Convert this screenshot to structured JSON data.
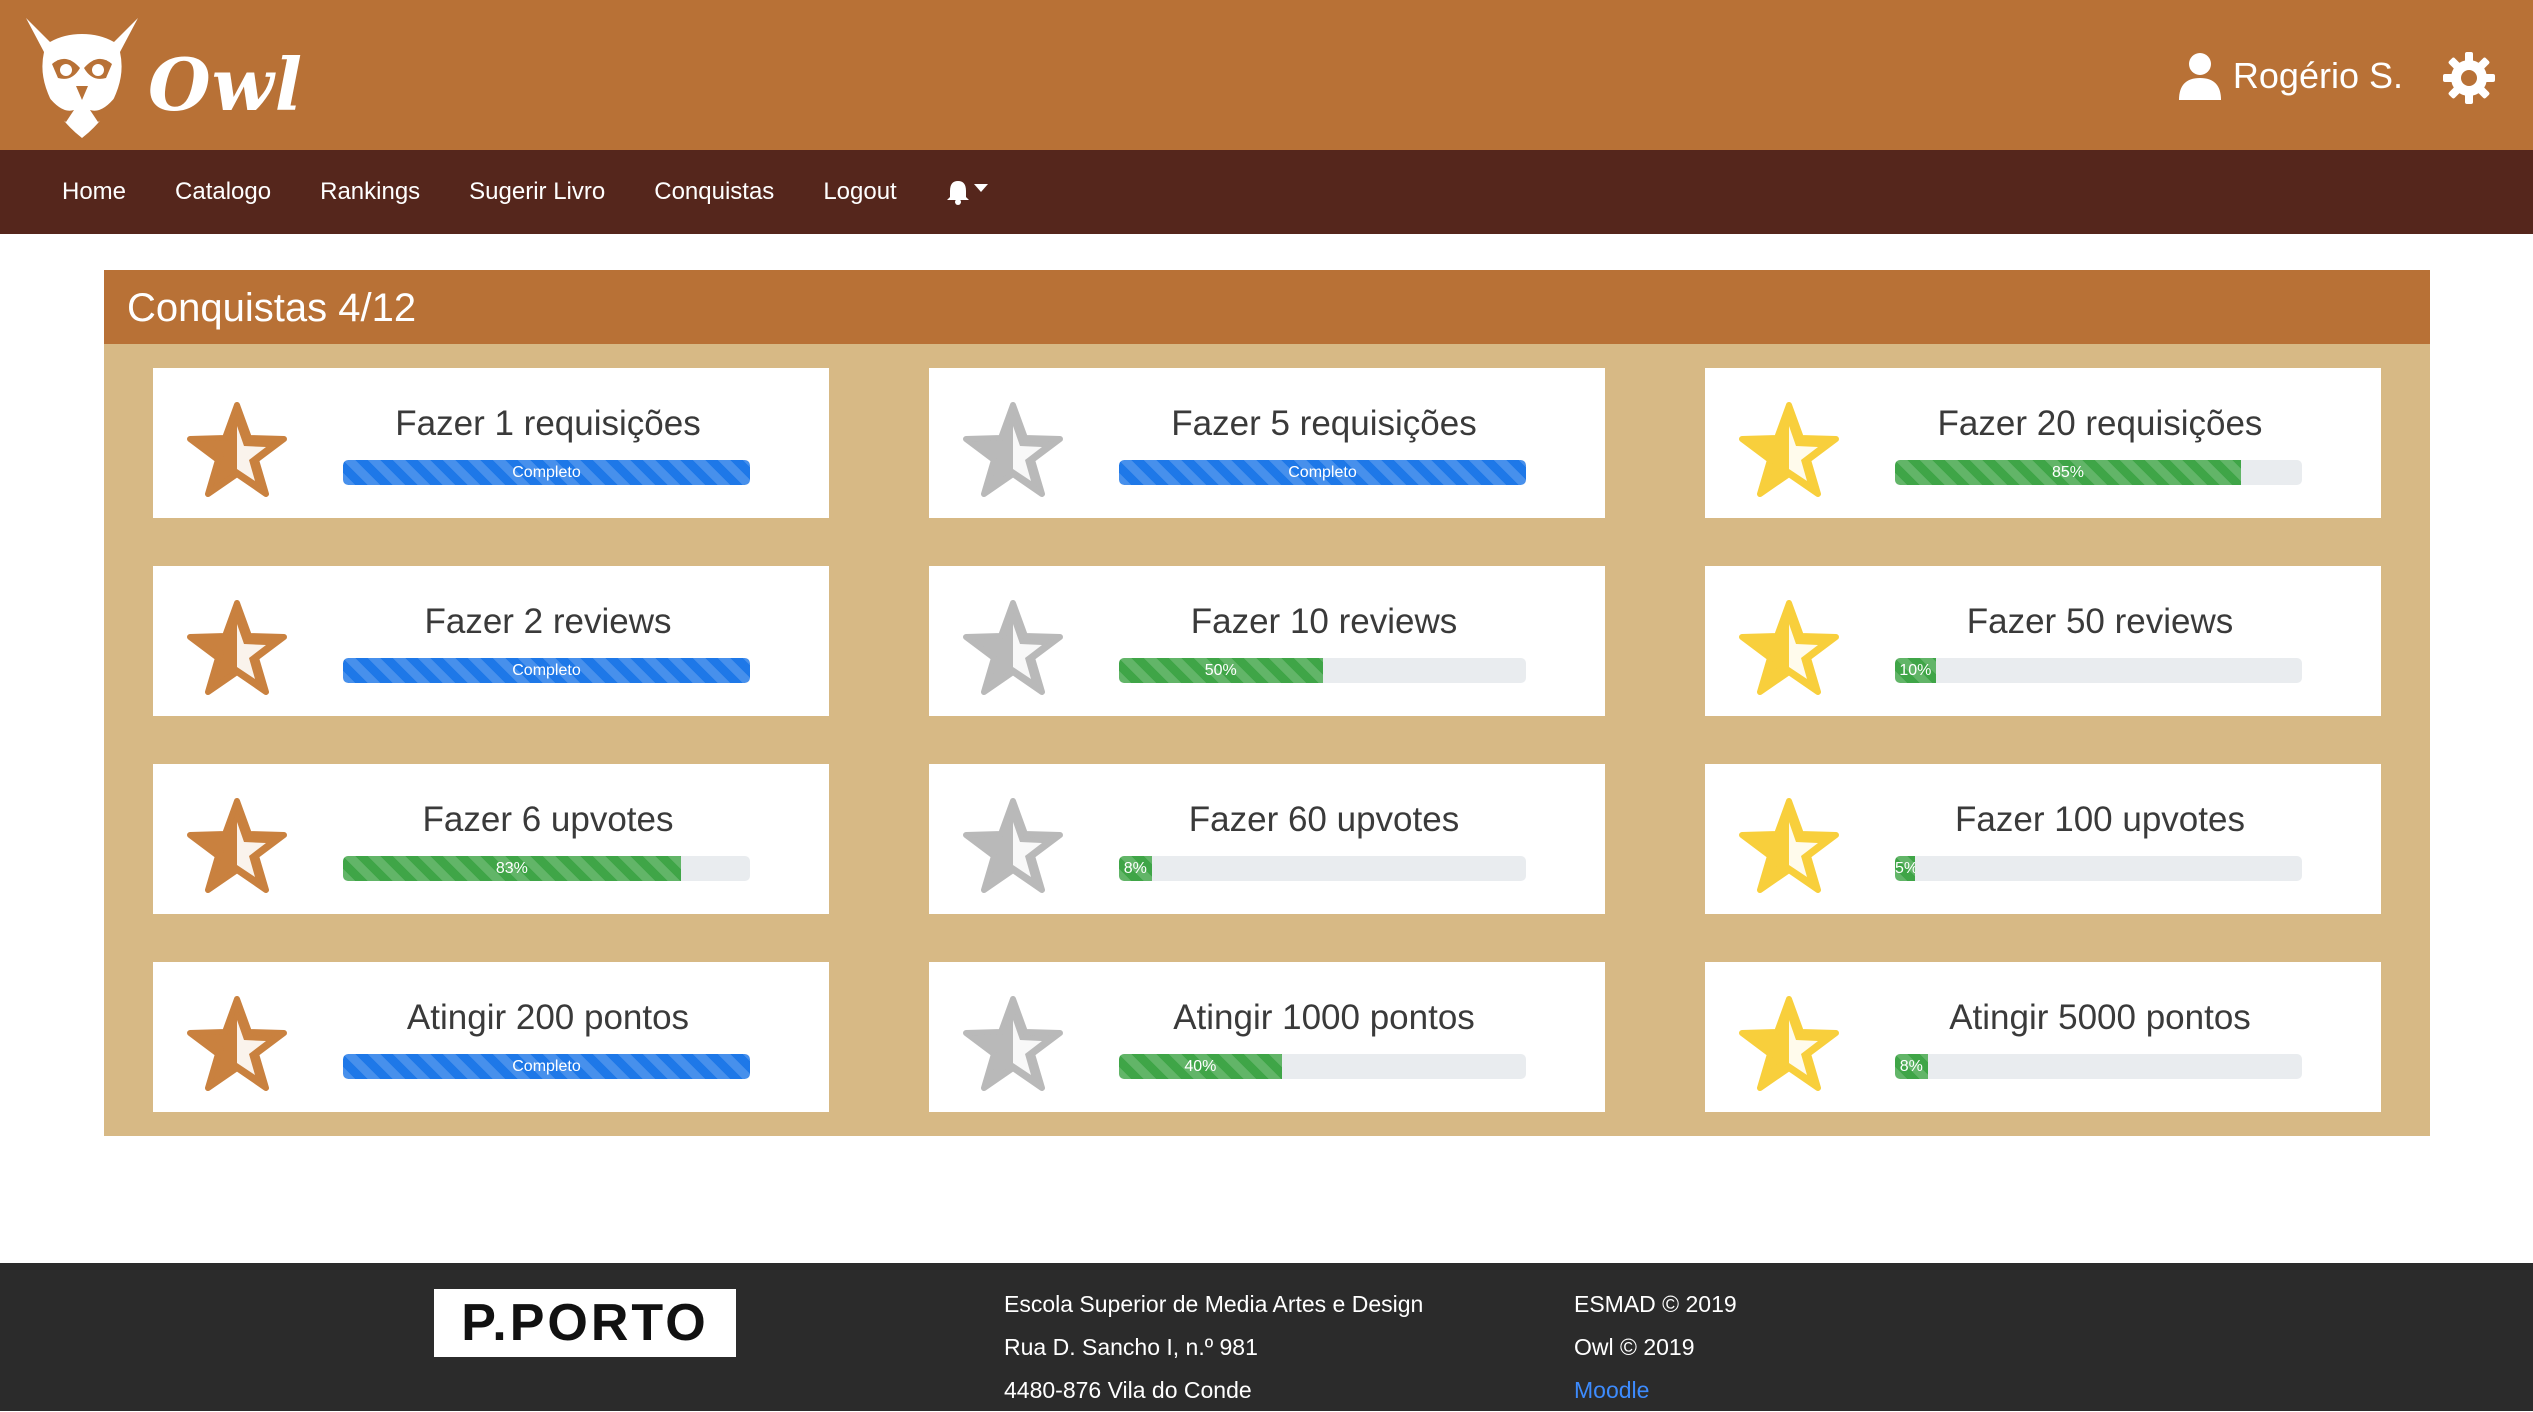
{
  "header": {
    "brand": "Owl",
    "user_name": "Rogério S."
  },
  "nav": {
    "items": [
      "Home",
      "Catalogo",
      "Rankings",
      "Sugerir Livro",
      "Conquistas",
      "Logout"
    ]
  },
  "panel": {
    "title": "Conquistas 4/12"
  },
  "colors": {
    "bronze": "#c9813f",
    "silver": "#b9b9b9",
    "gold": "#f8cf3c",
    "header": "#b87136",
    "nav": "#55261c",
    "panel": "#d7b985",
    "complete": "#1e78e8",
    "progress": "#3fa547"
  },
  "achievements": [
    {
      "title": "Fazer 1 requisições",
      "star": "bronze",
      "progress": 100,
      "label": "Completo",
      "status": "complete"
    },
    {
      "title": "Fazer 5 requisições",
      "star": "silver",
      "progress": 100,
      "label": "Completo",
      "status": "complete"
    },
    {
      "title": "Fazer 20 requisições",
      "star": "gold",
      "progress": 85,
      "label": "85%",
      "status": "progress"
    },
    {
      "title": "Fazer 2 reviews",
      "star": "bronze",
      "progress": 100,
      "label": "Completo",
      "status": "complete"
    },
    {
      "title": "Fazer 10 reviews",
      "star": "silver",
      "progress": 50,
      "label": "50%",
      "status": "progress"
    },
    {
      "title": "Fazer 50 reviews",
      "star": "gold",
      "progress": 10,
      "label": "10%",
      "status": "progress"
    },
    {
      "title": "Fazer 6 upvotes",
      "star": "bronze",
      "progress": 83,
      "label": "83%",
      "status": "progress"
    },
    {
      "title": "Fazer 60 upvotes",
      "star": "silver",
      "progress": 8,
      "label": "8%",
      "status": "progress"
    },
    {
      "title": "Fazer 100 upvotes",
      "star": "gold",
      "progress": 5,
      "label": "5%",
      "status": "progress"
    },
    {
      "title": "Atingir 200 pontos",
      "star": "bronze",
      "progress": 100,
      "label": "Completo",
      "status": "complete"
    },
    {
      "title": "Atingir 1000 pontos",
      "star": "silver",
      "progress": 40,
      "label": "40%",
      "status": "progress"
    },
    {
      "title": "Atingir 5000 pontos",
      "star": "gold",
      "progress": 8,
      "label": "8%",
      "status": "progress"
    }
  ],
  "footer": {
    "logo_text": "P.PORTO",
    "school": "Escola Superior de Media Artes e Design",
    "address1": "Rua D. Sancho I, n.º 981",
    "address2": "4480-876 Vila do Conde",
    "copy1": "ESMAD © 2019",
    "copy2": "Owl © 2019",
    "link": "Moodle"
  }
}
